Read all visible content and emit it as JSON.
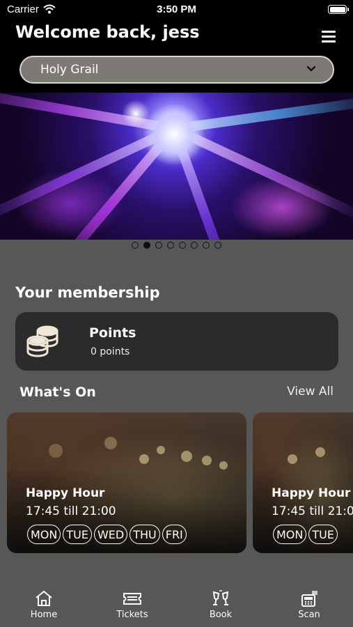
{
  "status_bar": {
    "carrier": "Carrier",
    "time": "3:50 PM"
  },
  "header": {
    "welcome": "Welcome back, jess"
  },
  "venue_select": {
    "selected": "Holy Grail"
  },
  "carousel": {
    "slide_count": 8,
    "active_index": 1
  },
  "membership": {
    "section_title": "Your membership",
    "points_title": "Points",
    "points_value": "0 points"
  },
  "whats_on": {
    "title": "What's On",
    "view_all": "View All",
    "events": [
      {
        "title": "Happy Hour",
        "time": "17:45 till 21:00",
        "days": [
          "MON",
          "TUE",
          "WED",
          "THU",
          "FRI"
        ]
      },
      {
        "title": "Happy Hour",
        "time": "17:45 till 21:00",
        "days": [
          "MON",
          "TUE"
        ]
      }
    ]
  },
  "tabbar": {
    "items": [
      {
        "label": "Home",
        "icon": "home-icon"
      },
      {
        "label": "Tickets",
        "icon": "ticket-icon"
      },
      {
        "label": "Book",
        "icon": "cheers-glasses-icon"
      },
      {
        "label": "Scan",
        "icon": "register-scan-icon"
      }
    ]
  },
  "colors": {
    "background": "#575757",
    "header": "#000000",
    "card": "#2b2b2b",
    "select_fill": "#7d7975"
  }
}
